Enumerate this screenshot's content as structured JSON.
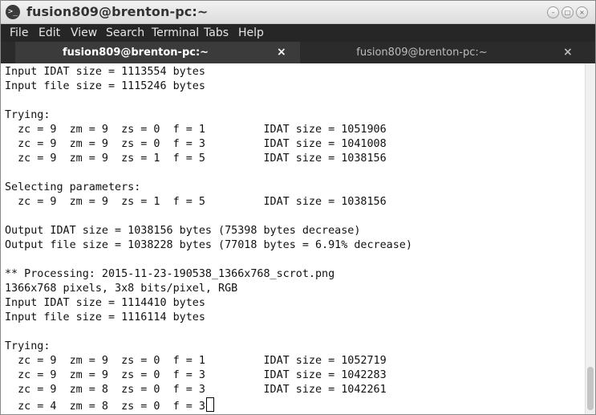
{
  "window": {
    "title": "fusion809@brenton-pc:~",
    "app_icon": ">_",
    "buttons": {
      "minimize": "–",
      "maximize": "□",
      "close": "×"
    }
  },
  "menu": [
    "File",
    "Edit",
    "View",
    "Search",
    "Terminal",
    "Tabs",
    "Help"
  ],
  "tabs": [
    {
      "label": "fusion809@brenton-pc:~",
      "close": "×",
      "active": true
    },
    {
      "label": "fusion809@brenton-pc:~",
      "close": "×",
      "active": false
    }
  ],
  "terminal": {
    "lines": [
      "Input IDAT size = 1113554 bytes",
      "Input file size = 1115246 bytes",
      "",
      "Trying:",
      "  zc = 9  zm = 9  zs = 0  f = 1         IDAT size = 1051906",
      "  zc = 9  zm = 9  zs = 0  f = 3         IDAT size = 1041008",
      "  zc = 9  zm = 9  zs = 1  f = 5         IDAT size = 1038156",
      "",
      "Selecting parameters:",
      "  zc = 9  zm = 9  zs = 1  f = 5         IDAT size = 1038156",
      "",
      "Output IDAT size = 1038156 bytes (75398 bytes decrease)",
      "Output file size = 1038228 bytes (77018 bytes = 6.91% decrease)",
      "",
      "** Processing: 2015-11-23-190538_1366x768_scrot.png",
      "1366x768 pixels, 3x8 bits/pixel, RGB",
      "Input IDAT size = 1114410 bytes",
      "Input file size = 1116114 bytes",
      "",
      "Trying:",
      "  zc = 9  zm = 9  zs = 0  f = 1         IDAT size = 1052719",
      "  zc = 9  zm = 9  zs = 0  f = 3         IDAT size = 1042283",
      "  zc = 9  zm = 8  zs = 0  f = 3         IDAT size = 1042261",
      "  zc = 4  zm = 8  zs = 0  f = 3"
    ]
  }
}
